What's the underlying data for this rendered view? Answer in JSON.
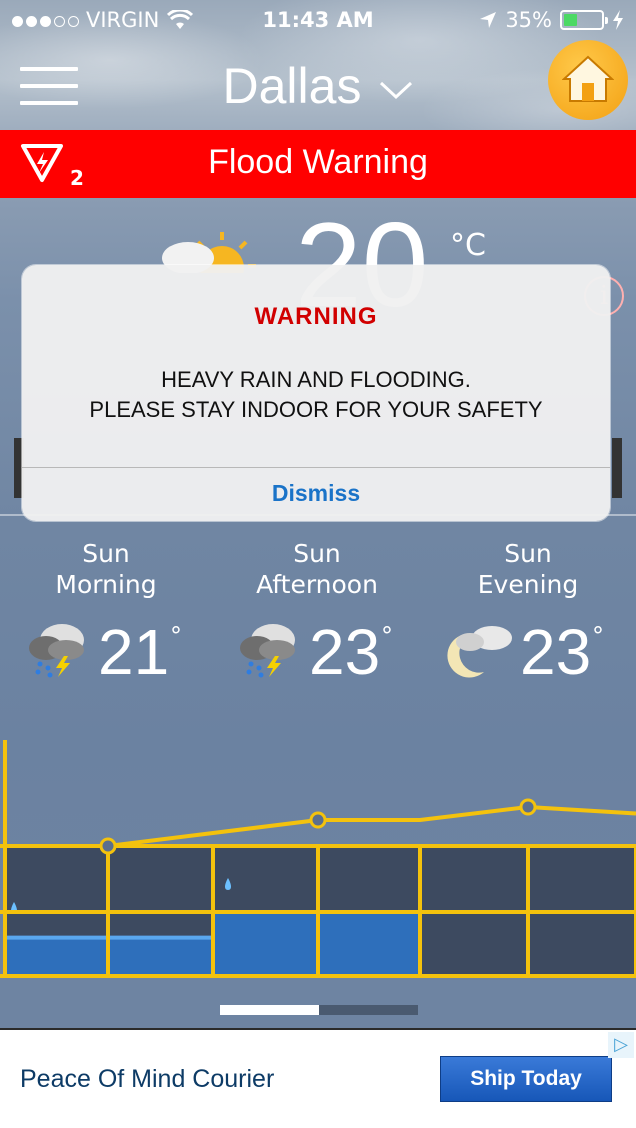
{
  "status_bar": {
    "carrier": "VIRGIN",
    "time": "11:43 AM",
    "battery": "35%",
    "battery_level": 0.35,
    "signal_bars": 3
  },
  "header": {
    "city": "Dallas",
    "city_chevron": "chevron-down-icon",
    "home_icon": "home-icon"
  },
  "alert_bar": {
    "title": "Flood Warning",
    "count": "2",
    "icon": "warning-triangle-icon",
    "info_icon": "info-icon",
    "info_glyph": "i"
  },
  "current": {
    "temp": "20",
    "unit": "°C"
  },
  "forecast": [
    {
      "day": "Sun",
      "part": "Morning",
      "temp": "21",
      "deg": "°",
      "icon": "thunderstorm-icon"
    },
    {
      "day": "Sun",
      "part": "Afternoon",
      "temp": "23",
      "deg": "°",
      "icon": "thunderstorm-icon"
    },
    {
      "day": "Sun",
      "part": "Evening",
      "temp": "23",
      "deg": "°",
      "icon": "partly-cloudy-night-icon"
    }
  ],
  "chart_data": {
    "type": "line",
    "series": [
      {
        "values": [
          2,
          2,
          3,
          4,
          4,
          5
        ]
      }
    ],
    "rain_bars": [
      0.6,
      0.6,
      1,
      1,
      0,
      0
    ],
    "grid": true
  },
  "pager": {
    "pages": 2,
    "active": 1
  },
  "ad": {
    "text": "Peace Of Mind Courier",
    "cta": "Ship Today",
    "adchoices_glyph": "▷"
  },
  "dialog": {
    "title": "WARNING",
    "line1": "HEAVY RAIN AND FLOODING.",
    "line2": "PLEASE STAY INDOOR FOR YOUR SAFETY",
    "button": "Dismiss"
  },
  "colors": {
    "alert_red": "#ff0000",
    "accent_yellow": "#f4c20d",
    "dismiss_blue": "#1a73c8",
    "home_orange": "#f3a012"
  }
}
